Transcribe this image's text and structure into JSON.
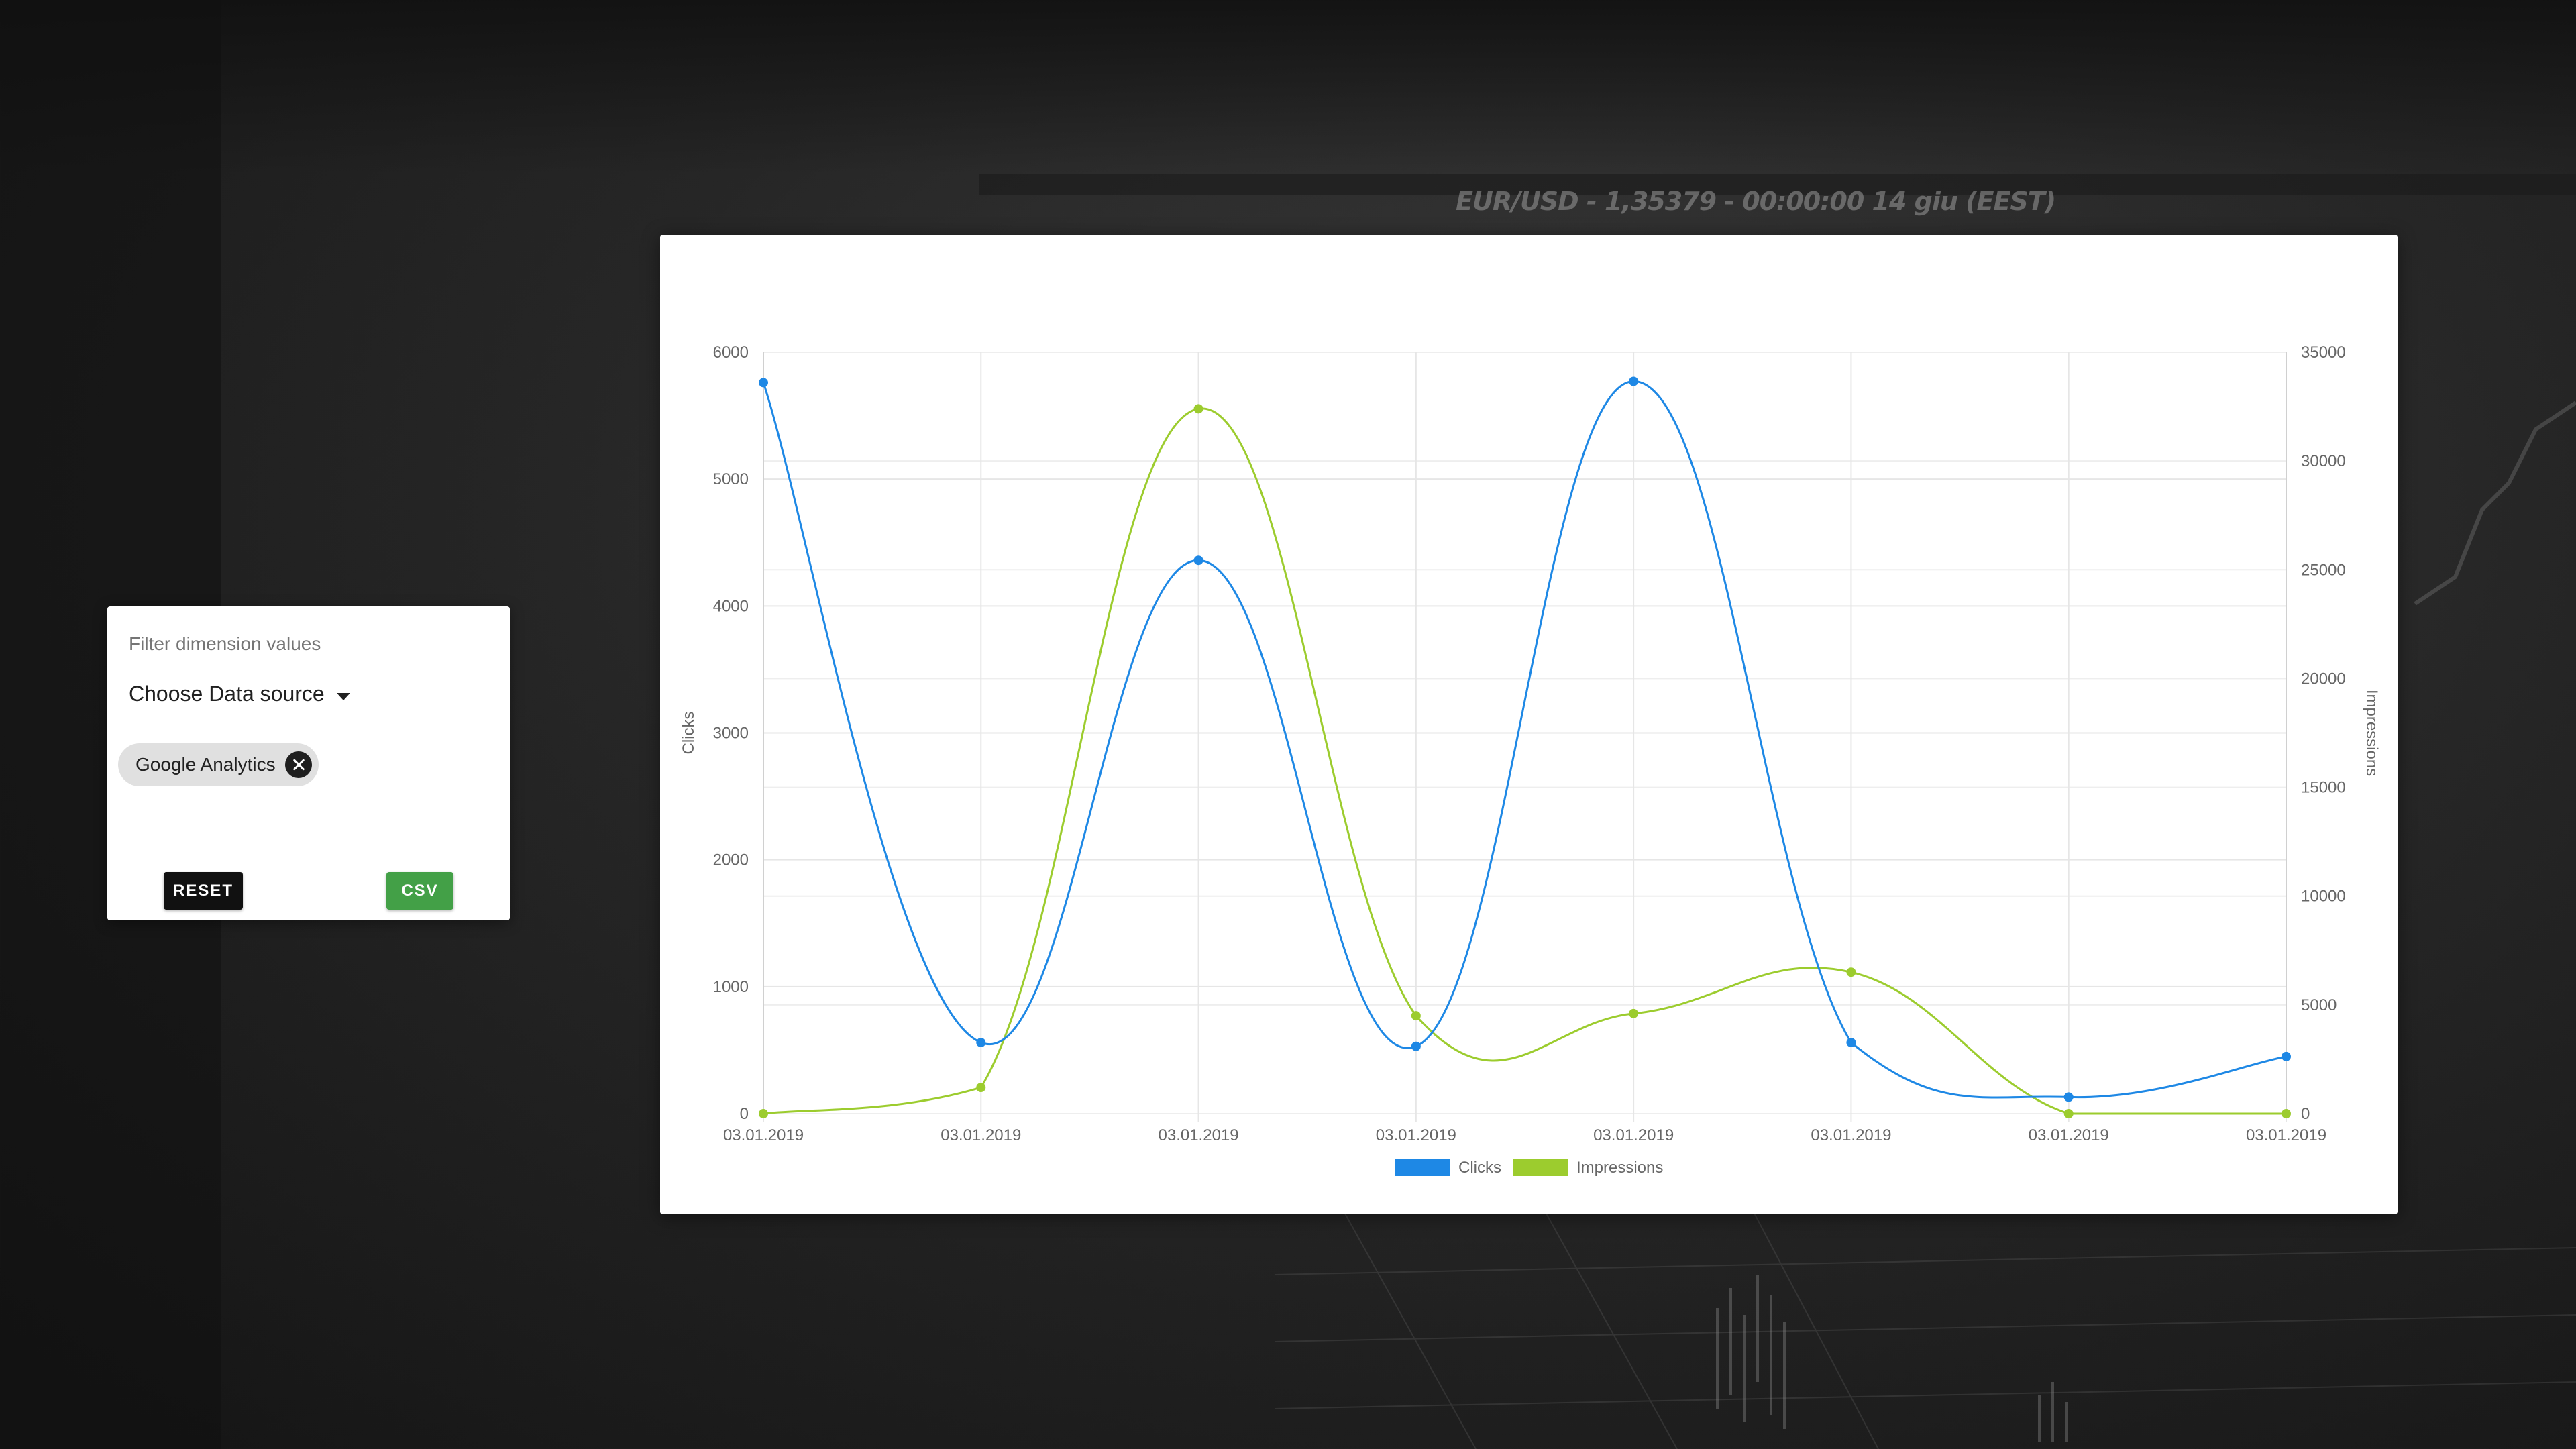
{
  "background": {
    "ticker_text": "EUR/USD - 1,35379 - 00:00:00  14 giu (EEST)"
  },
  "filter_panel": {
    "title": "Filter dimension values",
    "datasource_label": "Choose Data source",
    "chips": [
      {
        "label": "Google Analytics"
      }
    ],
    "reset_label": "RESET",
    "csv_label": "CSV",
    "csv_color": "#43a047",
    "reset_color": "#111111"
  },
  "chart_data": {
    "type": "line",
    "x": [
      "03.01.2019",
      "03.01.2019",
      "03.01.2019",
      "03.01.2019",
      "03.01.2019",
      "03.01.2019",
      "03.01.2019",
      "03.01.2019"
    ],
    "series": [
      {
        "name": "Clicks",
        "axis": "left",
        "color": "#1e88e5",
        "values": [
          5760,
          560,
          4360,
          530,
          5770,
          560,
          130,
          450
        ]
      },
      {
        "name": "Impressions",
        "axis": "right",
        "color": "#9ccc2e",
        "values": [
          0,
          1200,
          32400,
          4500,
          4600,
          6500,
          0,
          0
        ]
      }
    ],
    "ylabel": "Clicks",
    "y2label": "Impressions",
    "ylim": [
      0,
      6000
    ],
    "y2lim": [
      0,
      35000
    ],
    "yticks": [
      0,
      1000,
      2000,
      3000,
      4000,
      5000,
      6000
    ],
    "y2ticks": [
      0,
      5000,
      10000,
      15000,
      20000,
      25000,
      30000,
      35000
    ],
    "grid": true,
    "legend_position": "bottom",
    "smooth": true
  }
}
